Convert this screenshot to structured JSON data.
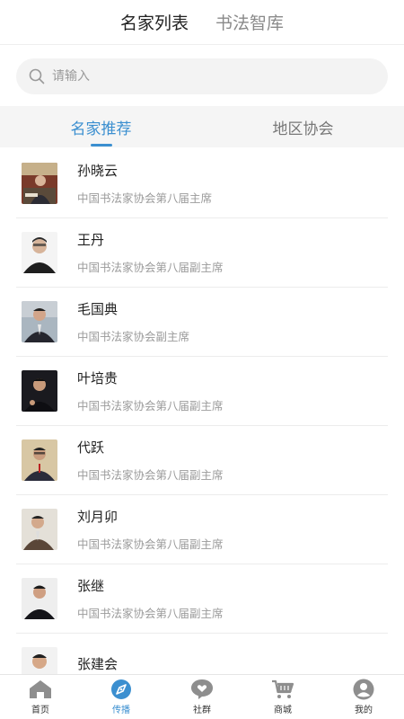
{
  "header": {
    "tabs": [
      {
        "label": "名家列表",
        "active": true
      },
      {
        "label": "书法智库",
        "active": false
      }
    ]
  },
  "search": {
    "placeholder": "请输入",
    "value": ""
  },
  "sub_tabs": [
    {
      "label": "名家推荐",
      "active": true
    },
    {
      "label": "地区协会",
      "active": false
    }
  ],
  "list": [
    {
      "name": "孙晓云",
      "title": "中国书法家协会第八届主席"
    },
    {
      "name": "王丹",
      "title": "中国书法家协会第八届副主席"
    },
    {
      "name": "毛国典",
      "title": "中国书法家协会副主席"
    },
    {
      "name": "叶培贵",
      "title": "中国书法家协会第八届副主席"
    },
    {
      "name": "代跃",
      "title": "中国书法家协会第八届副主席"
    },
    {
      "name": "刘月卯",
      "title": "中国书法家协会第八届副主席"
    },
    {
      "name": "张继",
      "title": "中国书法家协会第八届副主席"
    },
    {
      "name": "张建会",
      "title": ""
    }
  ],
  "bottom_nav": [
    {
      "label": "首页",
      "icon": "home-icon",
      "active": false
    },
    {
      "label": "传播",
      "icon": "compass-icon",
      "active": true
    },
    {
      "label": "社群",
      "icon": "chat-heart-icon",
      "active": false
    },
    {
      "label": "商城",
      "icon": "cart-icon",
      "active": false
    },
    {
      "label": "我的",
      "icon": "user-icon",
      "active": false
    }
  ],
  "colors": {
    "accent": "#3b8fd0",
    "icon_gray": "#8e8e8e",
    "sub_tab_bg": "#f5f5f5"
  }
}
